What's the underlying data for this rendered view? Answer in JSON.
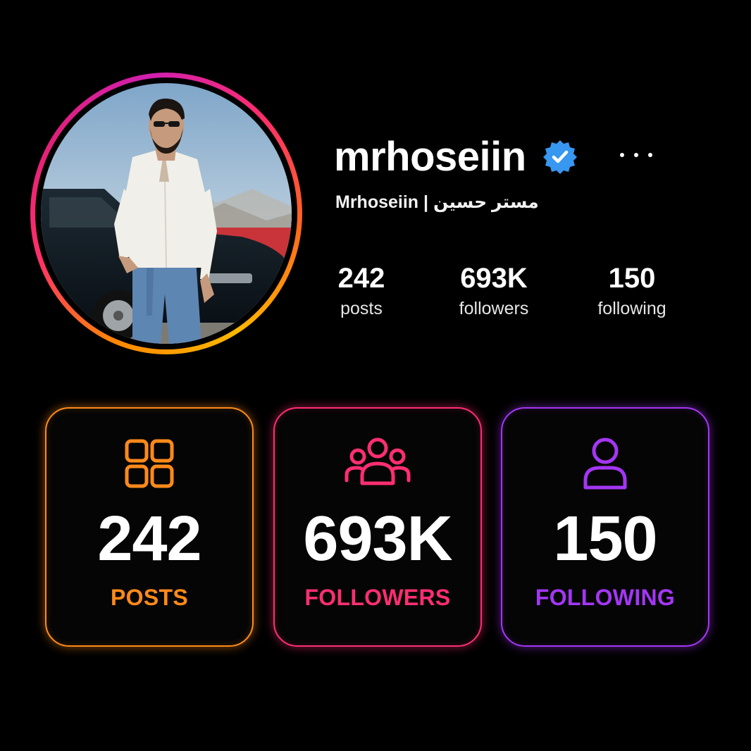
{
  "profile": {
    "username": "mrhoseiin",
    "full_name": "Mrhoseiin | مستر حسین",
    "verified": true,
    "avatar_icon": "profile-photo"
  },
  "stats": {
    "posts_value": "242",
    "posts_label": "posts",
    "followers_value": "693K",
    "followers_label": "followers",
    "following_value": "150",
    "following_label": "following"
  },
  "cards": [
    {
      "icon": "grid-icon",
      "value": "242",
      "label": "POSTS",
      "color": "#ff8a1a"
    },
    {
      "icon": "users-group-icon",
      "value": "693K",
      "label": "FOLLOWERS",
      "color": "#ff2e72"
    },
    {
      "icon": "user-icon",
      "value": "150",
      "label": "FOLLOWING",
      "color": "#a436f5"
    }
  ],
  "colors": {
    "background": "#000000",
    "verified_blue": "#3897f0",
    "ring_gradient": [
      "#ffb800",
      "#ff8a00",
      "#ff2e6a",
      "#d11fb0"
    ]
  }
}
